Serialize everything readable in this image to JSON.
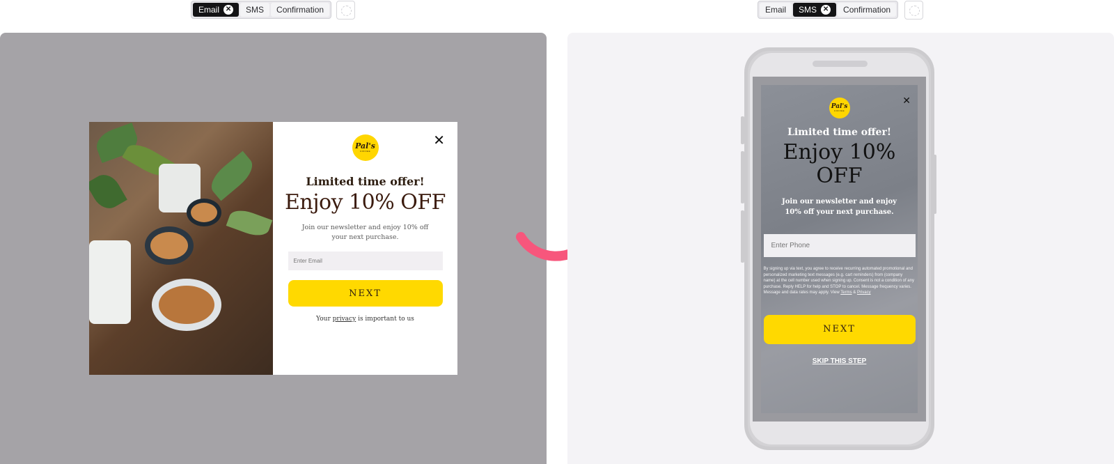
{
  "left_tabs": {
    "tabs": [
      {
        "label": "Email",
        "active": true
      },
      {
        "label": "SMS",
        "active": false
      },
      {
        "label": "Confirmation",
        "active": false
      }
    ]
  },
  "right_tabs": {
    "tabs": [
      {
        "label": "Email",
        "active": false
      },
      {
        "label": "SMS",
        "active": true
      },
      {
        "label": "Confirmation",
        "active": false
      }
    ]
  },
  "brand": {
    "name": "Pal's",
    "sub": "COFFEE",
    "accent": "#ffd900"
  },
  "email_popup": {
    "subtitle": "Limited time offer!",
    "headline": "Enjoy 10% OFF",
    "description": "Join our newsletter and enjoy 10% off your next purchase.",
    "input_placeholder": "Enter Email",
    "button_label": "NEXT",
    "privacy_prefix": "Your",
    "privacy_link": "privacy",
    "privacy_suffix": "is important to us"
  },
  "sms_popup": {
    "subtitle": "Limited time offer!",
    "headline": "Enjoy 10% OFF",
    "description": "Join our newsletter and enjoy 10% off your next purchase.",
    "input_placeholder": "Enter Phone",
    "legal_text": "By signing up via text, you agree to receive recurring automated promotional and personalized marketing text messages (e.g. cart reminders) from (company name) at the cell number used when signing up. Consent is not a condition of any purchase. Reply HELP for help and STOP to cancel. Message frequency varies. Message and data rates may apply. View",
    "terms_link": "Terms",
    "amp": "&",
    "privacy_link": "Privacy",
    "button_label": "NEXT",
    "skip_label": "SKIP THIS STEP"
  },
  "icons": {
    "close": "close-icon",
    "arrow": "curved-arrow-icon",
    "remove": "x-circle-icon"
  },
  "colors": {
    "arrow": "#f7567c",
    "left_bg": "#a5a3a7",
    "right_bg": "#f4f3f6"
  }
}
